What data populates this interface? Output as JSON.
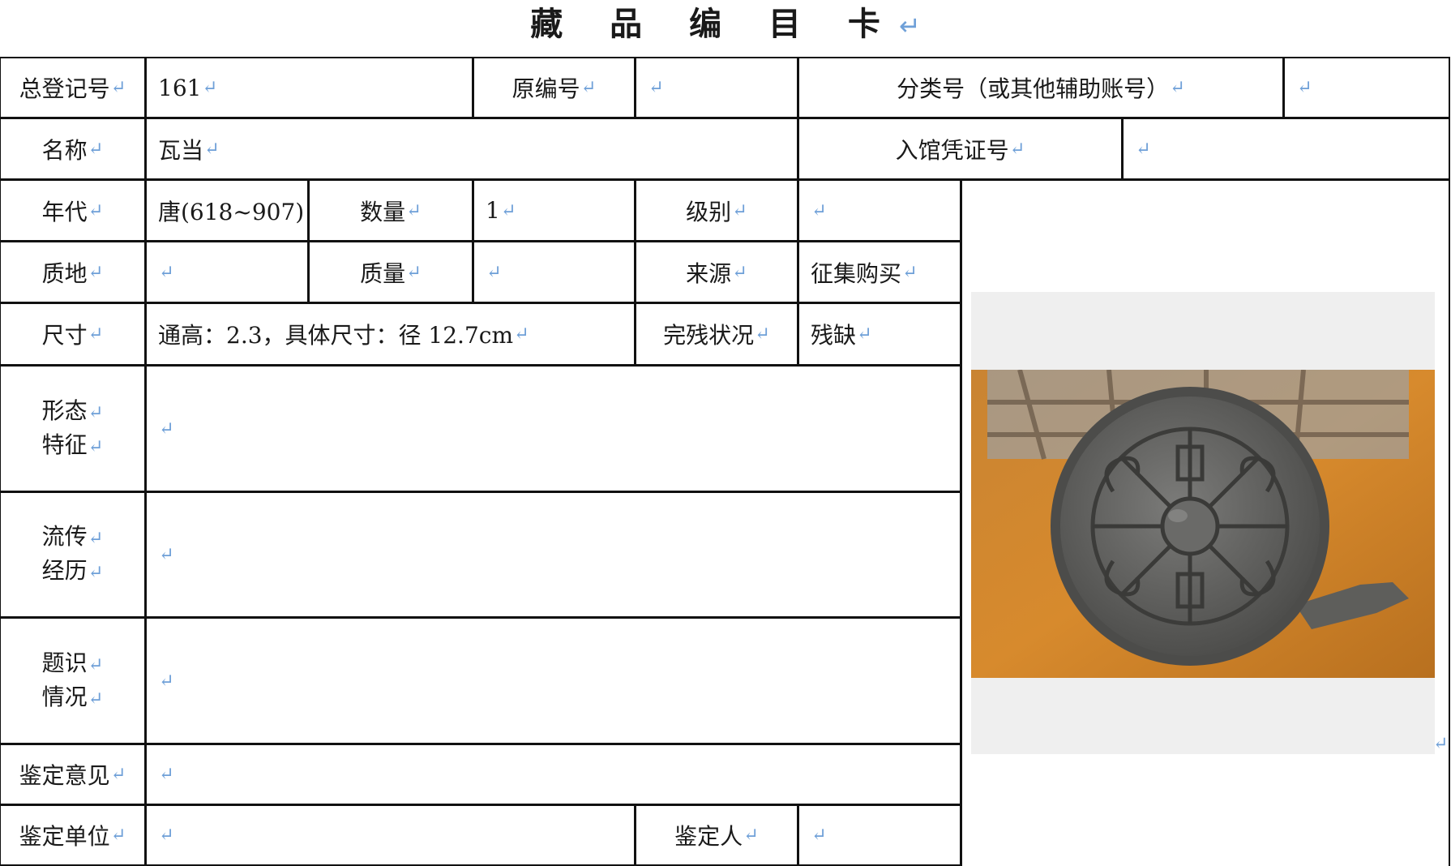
{
  "title": "藏 品 编 目 卡",
  "para_mark": "↵",
  "labels": {
    "total_reg_no": "总登记号",
    "orig_no": "原编号",
    "class_no": "分类号（或其他辅助账号）",
    "name": "名称",
    "entry_voucher": "入馆凭证号",
    "era": "年代",
    "quantity": "数量",
    "level": "级别",
    "material": "质地",
    "weight": "质量",
    "source": "来源",
    "size": "尺寸",
    "condition": "完残状况",
    "form_1": "形态",
    "form_2": "特征",
    "history_1": "流传",
    "history_2": "经历",
    "inscription_1": "题识",
    "inscription_2": "情况",
    "appraisal_opinion": "鉴定意见",
    "appraisal_unit": "鉴定单位",
    "appraiser": "鉴定人"
  },
  "values": {
    "total_reg_no": "161",
    "orig_no": "",
    "class_no": "",
    "name": "瓦当",
    "entry_voucher": "",
    "era": "唐(618~907)",
    "quantity": "1",
    "level": "",
    "material": "",
    "weight": "",
    "source": "征集购买",
    "size": "通高：2.3，具体尺寸：径 12.7cm",
    "condition": "残缺",
    "form": "",
    "history": "",
    "inscription": "",
    "appraisal_opinion": "",
    "appraisal_unit": "",
    "appraiser": ""
  },
  "colors": {
    "border": "#111111",
    "para_mark": "#6fa0d8"
  }
}
